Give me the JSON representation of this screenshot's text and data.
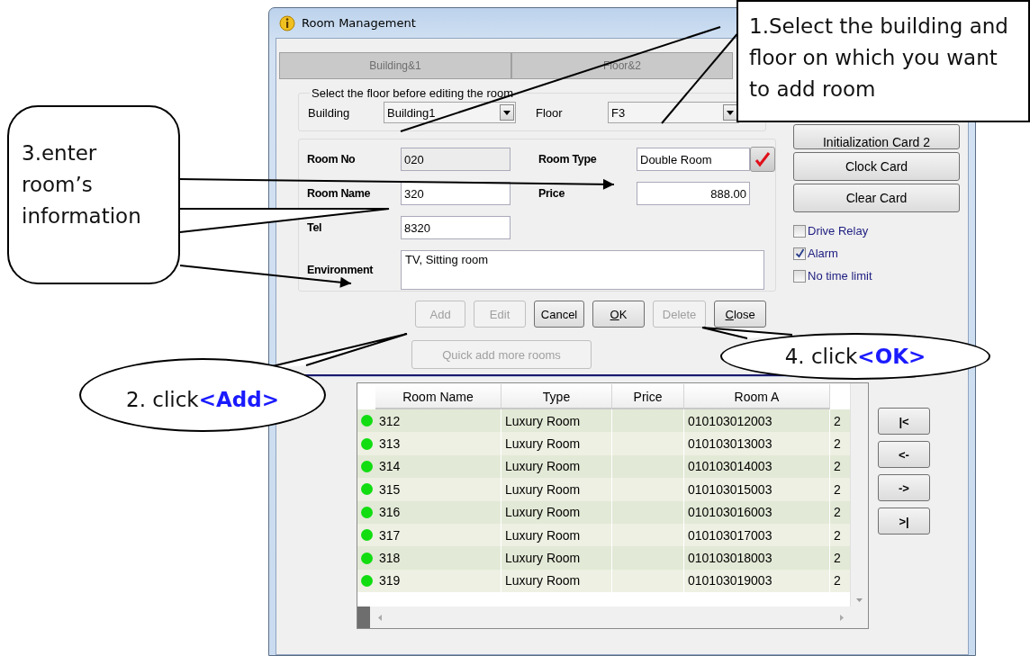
{
  "window": {
    "title": "Room Management"
  },
  "tabs": [
    {
      "label": "Building&1",
      "disabled": true
    },
    {
      "label": "Floor&2",
      "disabled": true
    }
  ],
  "location": {
    "legend": "Select the floor before editing the room",
    "building_label": "Building",
    "building": "Building1",
    "floor_label": "Floor",
    "floor": "F3"
  },
  "room": {
    "room_no_label": "Room No",
    "room_no": "020",
    "room_no_readonly": true,
    "room_type_label": "Room Type",
    "room_type": "Double Room",
    "room_name_label": "Room Name",
    "room_name": "320",
    "price_label": "Price",
    "price": "888.00",
    "tel_label": "Tel",
    "tel": "8320",
    "environment_label": "Environment",
    "environment": "TV, Sitting room"
  },
  "side_buttons": [
    "Initialization Card 2",
    "Clock Card",
    "Clear Card"
  ],
  "options": [
    {
      "label": "Drive Relay",
      "checked": false
    },
    {
      "label": "Alarm",
      "checked": true
    },
    {
      "label": "No time limit",
      "checked": false
    }
  ],
  "actions": [
    {
      "label": "Add",
      "disabled": true,
      "access_key": false
    },
    {
      "label": "Edit",
      "disabled": true,
      "access_key": false
    },
    {
      "label": "Cancel",
      "disabled": false,
      "access_key": false
    },
    {
      "label": "OK",
      "disabled": false,
      "access_key": true
    },
    {
      "label": "Delete",
      "disabled": true,
      "access_key": false
    },
    {
      "label": "Close",
      "disabled": false,
      "access_key": true
    }
  ],
  "quick_add": {
    "label": "Quick add more rooms",
    "disabled": true
  },
  "table": {
    "columns": [
      "Room Name",
      "Type",
      "Price",
      "Room A"
    ],
    "rows": [
      {
        "color": "#11dd11",
        "room_name": "312",
        "type": "Luxury Room",
        "column_4": "010103012003",
        "column_5": "2"
      },
      {
        "color": "#11dd11",
        "room_name": "313",
        "type": "Luxury Room",
        "column_4": "010103013003",
        "column_5": "2"
      },
      {
        "color": "#11dd11",
        "room_name": "314",
        "type": "Luxury Room",
        "column_4": "010103014003",
        "column_5": "2"
      },
      {
        "color": "#11dd11",
        "room_name": "315",
        "type": "Luxury Room",
        "column_4": "010103015003",
        "column_5": "2"
      },
      {
        "color": "#11dd11",
        "room_name": "316",
        "type": "Luxury Room",
        "column_4": "010103016003",
        "column_5": "2"
      },
      {
        "color": "#11dd11",
        "room_name": "317",
        "type": "Luxury Room",
        "column_4": "010103017003",
        "column_5": "2"
      },
      {
        "color": "#11dd11",
        "room_name": "318",
        "type": "Luxury Room",
        "column_4": "010103018003",
        "column_5": "2"
      },
      {
        "color": "#11dd11",
        "room_name": "319",
        "type": "Luxury Room",
        "column_4": "010103019003",
        "column_5": "2"
      }
    ]
  },
  "nav_buttons": [
    "|<",
    "<-",
    "->",
    ">|"
  ],
  "callouts": [
    {
      "kind": "box",
      "text": "1.Select the building and floor on which you want to add room"
    },
    {
      "kind": "rounded",
      "text": "3.enter room’s information"
    },
    {
      "kind": "ellipse",
      "text": "2. click**<Add>**"
    },
    {
      "kind": "ellipse",
      "text": "4. click**<OK>**"
    }
  ]
}
